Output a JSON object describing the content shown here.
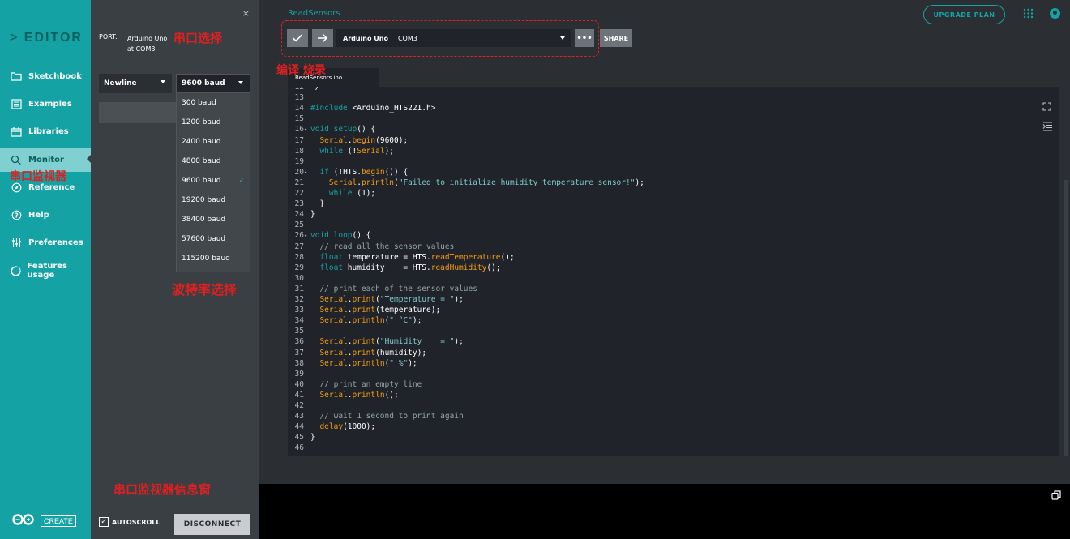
{
  "sidebar": {
    "brand": "> EDITOR",
    "items": [
      {
        "label": "Sketchbook",
        "icon": "folder-icon"
      },
      {
        "label": "Examples",
        "icon": "list-icon"
      },
      {
        "label": "Libraries",
        "icon": "library-icon"
      },
      {
        "label": "Monitor",
        "icon": "monitor-icon"
      },
      {
        "label": "Reference",
        "icon": "compass-icon"
      },
      {
        "label": "Help",
        "icon": "help-icon"
      },
      {
        "label": "Preferences",
        "icon": "sliders-icon"
      },
      {
        "label": "Features usage",
        "icon": "pie-icon"
      }
    ],
    "logo_text": "CREATE"
  },
  "monitor_panel": {
    "close": "×",
    "port_label": "PORT:",
    "port_value_line1": "Arduino Uno",
    "port_value_line2": "at COM3",
    "line_ending": "Newline",
    "baud_selected": "9600 baud",
    "baud_options": [
      "300 baud",
      "1200 baud",
      "2400 baud",
      "4800 baud",
      "9600 baud",
      "19200 baud",
      "38400 baud",
      "57600 baud",
      "115200 baud"
    ],
    "autoscroll_label": "AUTOSCROLL",
    "disconnect_label": "DISCONNECT"
  },
  "header": {
    "sketch_name": "ReadSensors",
    "upgrade_label": "UPGRADE PLAN"
  },
  "toolbar": {
    "board_name": "Arduino Uno",
    "board_port": "COM3",
    "more_label": "•••",
    "share_label": "SHARE"
  },
  "editor": {
    "file_tab": "ReadSensors.ino",
    "lines": [
      {
        "n": "12",
        "fold": "",
        "tokens": [
          [
            "pl",
            " /"
          ]
        ]
      },
      {
        "n": "13",
        "fold": "",
        "tokens": []
      },
      {
        "n": "14",
        "fold": "",
        "tokens": [
          [
            "kw",
            "#include"
          ],
          [
            "pl",
            " <Arduino_HTS221.h>"
          ]
        ]
      },
      {
        "n": "15",
        "fold": "",
        "tokens": []
      },
      {
        "n": "16",
        "fold": "▾",
        "tokens": [
          [
            "kw",
            "void"
          ],
          [
            "pl",
            " "
          ],
          [
            "kw",
            "setup"
          ],
          [
            "pl",
            "() {"
          ]
        ]
      },
      {
        "n": "17",
        "fold": "",
        "tokens": [
          [
            "pl",
            "  "
          ],
          [
            "fn",
            "Serial"
          ],
          [
            "pl",
            "."
          ],
          [
            "fn",
            "begin"
          ],
          [
            "pl",
            "(9600);"
          ]
        ]
      },
      {
        "n": "18",
        "fold": "",
        "tokens": [
          [
            "pl",
            "  "
          ],
          [
            "kw",
            "while"
          ],
          [
            "pl",
            " (!"
          ],
          [
            "fn",
            "Serial"
          ],
          [
            "pl",
            ");"
          ]
        ]
      },
      {
        "n": "19",
        "fold": "",
        "tokens": []
      },
      {
        "n": "20",
        "fold": "▾",
        "tokens": [
          [
            "pl",
            "  "
          ],
          [
            "kw",
            "if"
          ],
          [
            "pl",
            " (!HTS."
          ],
          [
            "fn",
            "begin"
          ],
          [
            "pl",
            "()) {"
          ]
        ]
      },
      {
        "n": "21",
        "fold": "",
        "tokens": [
          [
            "pl",
            "    "
          ],
          [
            "fn",
            "Serial"
          ],
          [
            "pl",
            "."
          ],
          [
            "fn",
            "println"
          ],
          [
            "pl",
            "("
          ],
          [
            "str",
            "\"Failed to initialize humidity temperature sensor!\""
          ],
          [
            "pl",
            ");"
          ]
        ]
      },
      {
        "n": "22",
        "fold": "",
        "tokens": [
          [
            "pl",
            "    "
          ],
          [
            "kw",
            "while"
          ],
          [
            "pl",
            " (1);"
          ]
        ]
      },
      {
        "n": "23",
        "fold": "",
        "tokens": [
          [
            "pl",
            "  }"
          ]
        ]
      },
      {
        "n": "24",
        "fold": "",
        "tokens": [
          [
            "pl",
            "}"
          ]
        ]
      },
      {
        "n": "25",
        "fold": "",
        "tokens": []
      },
      {
        "n": "26",
        "fold": "▾",
        "tokens": [
          [
            "kw",
            "void"
          ],
          [
            "pl",
            " "
          ],
          [
            "kw",
            "loop"
          ],
          [
            "pl",
            "() {"
          ]
        ]
      },
      {
        "n": "27",
        "fold": "",
        "tokens": [
          [
            "pl",
            "  "
          ],
          [
            "cm",
            "// read all the sensor values"
          ]
        ]
      },
      {
        "n": "28",
        "fold": "",
        "tokens": [
          [
            "pl",
            "  "
          ],
          [
            "ty",
            "float"
          ],
          [
            "pl",
            " temperature = HTS."
          ],
          [
            "fn",
            "readTemperature"
          ],
          [
            "pl",
            "();"
          ]
        ]
      },
      {
        "n": "29",
        "fold": "",
        "tokens": [
          [
            "pl",
            "  "
          ],
          [
            "ty",
            "float"
          ],
          [
            "pl",
            " humidity    = HTS."
          ],
          [
            "fn",
            "readHumidity"
          ],
          [
            "pl",
            "();"
          ]
        ]
      },
      {
        "n": "30",
        "fold": "",
        "tokens": []
      },
      {
        "n": "31",
        "fold": "",
        "tokens": [
          [
            "pl",
            "  "
          ],
          [
            "cm",
            "// print each of the sensor values"
          ]
        ]
      },
      {
        "n": "32",
        "fold": "",
        "tokens": [
          [
            "pl",
            "  "
          ],
          [
            "fn",
            "Serial"
          ],
          [
            "pl",
            "."
          ],
          [
            "fn",
            "print"
          ],
          [
            "pl",
            "("
          ],
          [
            "str",
            "\"Temperature = \""
          ],
          [
            "pl",
            ");"
          ]
        ]
      },
      {
        "n": "33",
        "fold": "",
        "tokens": [
          [
            "pl",
            "  "
          ],
          [
            "fn",
            "Serial"
          ],
          [
            "pl",
            "."
          ],
          [
            "fn",
            "print"
          ],
          [
            "pl",
            "(temperature);"
          ]
        ]
      },
      {
        "n": "34",
        "fold": "",
        "tokens": [
          [
            "pl",
            "  "
          ],
          [
            "fn",
            "Serial"
          ],
          [
            "pl",
            "."
          ],
          [
            "fn",
            "println"
          ],
          [
            "pl",
            "("
          ],
          [
            "str",
            "\" °C\""
          ],
          [
            "pl",
            ");"
          ]
        ]
      },
      {
        "n": "35",
        "fold": "",
        "tokens": []
      },
      {
        "n": "36",
        "fold": "",
        "tokens": [
          [
            "pl",
            "  "
          ],
          [
            "fn",
            "Serial"
          ],
          [
            "pl",
            "."
          ],
          [
            "fn",
            "print"
          ],
          [
            "pl",
            "("
          ],
          [
            "str",
            "\"Humidity    = \""
          ],
          [
            "pl",
            ");"
          ]
        ]
      },
      {
        "n": "37",
        "fold": "",
        "tokens": [
          [
            "pl",
            "  "
          ],
          [
            "fn",
            "Serial"
          ],
          [
            "pl",
            "."
          ],
          [
            "fn",
            "print"
          ],
          [
            "pl",
            "(humidity);"
          ]
        ]
      },
      {
        "n": "38",
        "fold": "",
        "tokens": [
          [
            "pl",
            "  "
          ],
          [
            "fn",
            "Serial"
          ],
          [
            "pl",
            "."
          ],
          [
            "fn",
            "println"
          ],
          [
            "pl",
            "("
          ],
          [
            "str",
            "\" %\""
          ],
          [
            "pl",
            ");"
          ]
        ]
      },
      {
        "n": "39",
        "fold": "",
        "tokens": []
      },
      {
        "n": "40",
        "fold": "",
        "tokens": [
          [
            "pl",
            "  "
          ],
          [
            "cm",
            "// print an empty line"
          ]
        ]
      },
      {
        "n": "41",
        "fold": "",
        "tokens": [
          [
            "pl",
            "  "
          ],
          [
            "fn",
            "Serial"
          ],
          [
            "pl",
            "."
          ],
          [
            "fn",
            "println"
          ],
          [
            "pl",
            "();"
          ]
        ]
      },
      {
        "n": "42",
        "fold": "",
        "tokens": []
      },
      {
        "n": "43",
        "fold": "",
        "tokens": [
          [
            "pl",
            "  "
          ],
          [
            "cm",
            "// wait 1 second to print again"
          ]
        ]
      },
      {
        "n": "44",
        "fold": "",
        "tokens": [
          [
            "pl",
            "  "
          ],
          [
            "fn",
            "delay"
          ],
          [
            "pl",
            "(1000);"
          ]
        ]
      },
      {
        "n": "45",
        "fold": "",
        "tokens": [
          [
            "pl",
            "}"
          ]
        ]
      },
      {
        "n": "46",
        "fold": "",
        "tokens": []
      }
    ]
  },
  "annotations": {
    "port_select": "串口选择",
    "compile_upload": "编译  烧录",
    "serial_monitor": "串口监视器",
    "baud_select": "波特率选择",
    "monitor_window": "串口监视器信息窗"
  },
  "colors": {
    "brand_teal": "#14a2a4",
    "annotation_red": "#e02020",
    "editor_bg": "#20242a",
    "panel_bg": "#3a3f44"
  }
}
